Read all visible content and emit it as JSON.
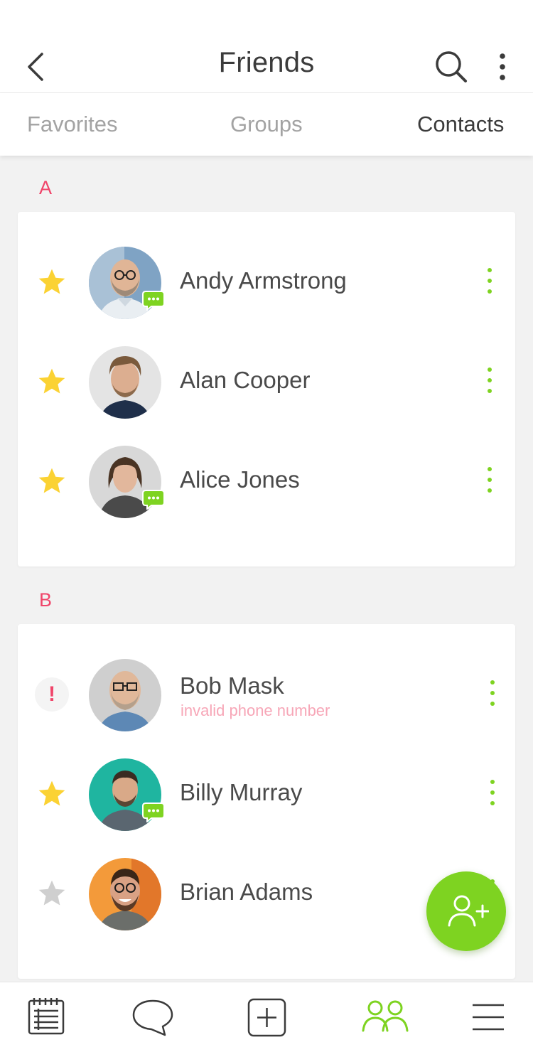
{
  "header": {
    "title": "Friends",
    "back_icon": "chevron-left-icon",
    "search_icon": "search-icon",
    "more_icon": "more-vertical-icon"
  },
  "tabs": [
    {
      "label": "Favorites",
      "active": false
    },
    {
      "label": "Groups",
      "active": false
    },
    {
      "label": "Contacts",
      "active": true
    }
  ],
  "sections": [
    {
      "letter": "A",
      "contacts": [
        {
          "name": "Andy Armstrong",
          "lead": "star",
          "favorite": true,
          "chat_badge": true
        },
        {
          "name": "Alan Cooper",
          "lead": "star",
          "favorite": true,
          "chat_badge": false
        },
        {
          "name": "Alice Jones",
          "lead": "star",
          "favorite": true,
          "chat_badge": true
        }
      ]
    },
    {
      "letter": "B",
      "contacts": [
        {
          "name": "Bob Mask",
          "lead": "alert",
          "subtitle": "invalid phone number",
          "chat_badge": false,
          "alert_glyph": "!"
        },
        {
          "name": "Billy Murray",
          "lead": "star",
          "favorite": true,
          "chat_badge": true
        },
        {
          "name": "Brian Adams",
          "lead": "star",
          "favorite": false,
          "chat_badge": false
        }
      ]
    }
  ],
  "fab": {
    "icon": "add-user-icon"
  },
  "bottom_nav": [
    {
      "icon": "notes-icon",
      "active": false
    },
    {
      "icon": "chat-icon",
      "active": false
    },
    {
      "icon": "add-square-icon",
      "active": false
    },
    {
      "icon": "friends-icon",
      "active": true
    },
    {
      "icon": "menu-icon",
      "active": false
    }
  ],
  "colors": {
    "accent_green": "#7ed321",
    "star_yellow": "#fbd233",
    "star_gray": "#cfcfcf",
    "section_letter_red": "#f0456a",
    "error_text_pink": "#f7a6b7",
    "background": "#f2f2f2"
  }
}
